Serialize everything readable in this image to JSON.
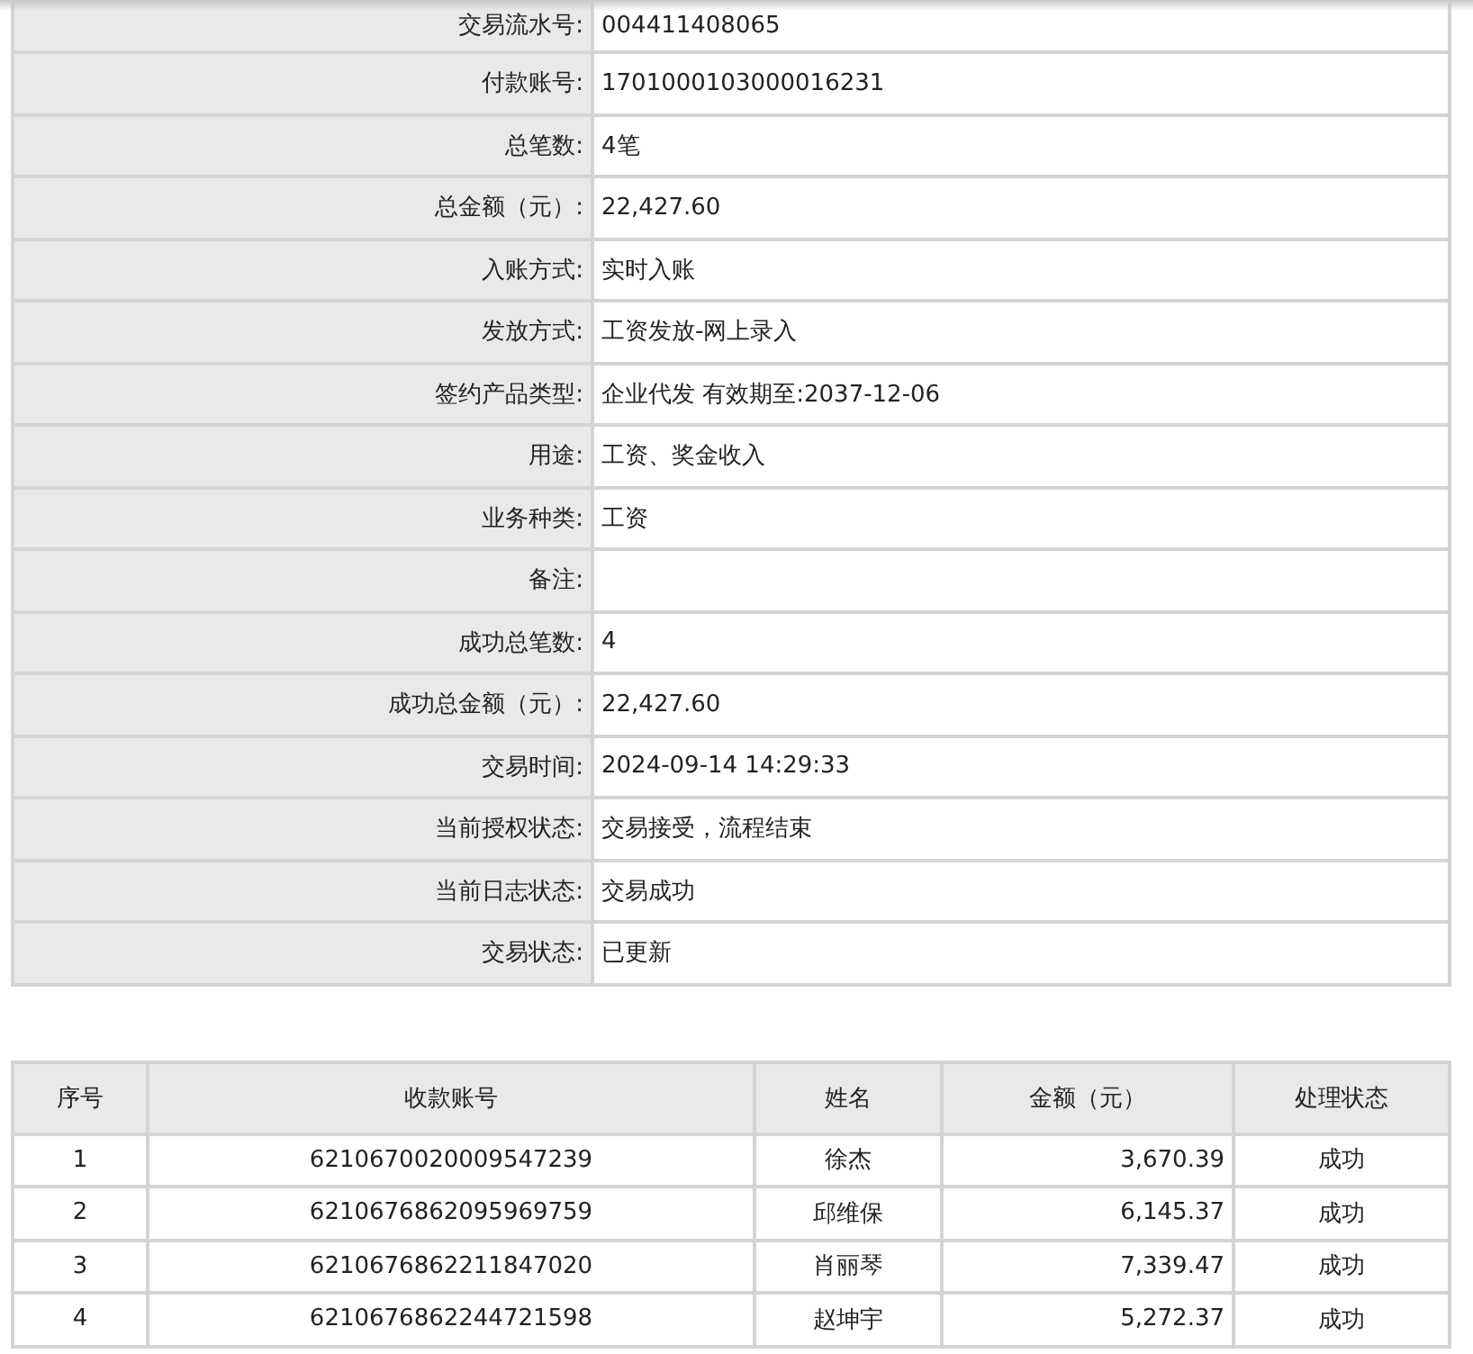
{
  "details": [
    {
      "label": "交易流水号:",
      "value": "004411408065"
    },
    {
      "label": "付款账号:",
      "value": "1701000103000016231"
    },
    {
      "label": "总笔数:",
      "value": "4笔"
    },
    {
      "label": "总金额（元）:",
      "value": "22,427.60"
    },
    {
      "label": "入账方式:",
      "value": "实时入账"
    },
    {
      "label": "发放方式:",
      "value": "工资发放-网上录入"
    },
    {
      "label": "签约产品类型:",
      "value": "企业代发 有效期至:2037-12-06"
    },
    {
      "label": "用途:",
      "value": "工资、奖金收入"
    },
    {
      "label": "业务种类:",
      "value": "工资"
    },
    {
      "label": "备注:"
    },
    {
      "label": "成功总笔数:",
      "value": "4"
    },
    {
      "label": "成功总金额（元）:",
      "value": "22,427.60"
    },
    {
      "label": "交易时间:",
      "value": "2024-09-14 14:29:33"
    },
    {
      "label": "当前授权状态:",
      "value": "交易接受，流程结束"
    },
    {
      "label": "当前日志状态:",
      "value": "交易成功"
    },
    {
      "label": "交易状态:",
      "value": "已更新"
    }
  ],
  "table": {
    "columns": [
      "序号",
      "收款账号",
      "姓名",
      "金额（元）",
      "处理状态"
    ],
    "rows": [
      [
        "1",
        "6210670020009547239",
        "徐杰",
        "3,670.39",
        "成功"
      ],
      [
        "2",
        "6210676862095969759",
        "邱维保",
        "6,145.37",
        "成功"
      ],
      [
        "3",
        "6210676862211847020",
        "肖丽琴",
        "7,339.47",
        "成功"
      ],
      [
        "4",
        "6210676862244721598",
        "赵坤宇",
        "5,272.37",
        "成功"
      ]
    ]
  }
}
